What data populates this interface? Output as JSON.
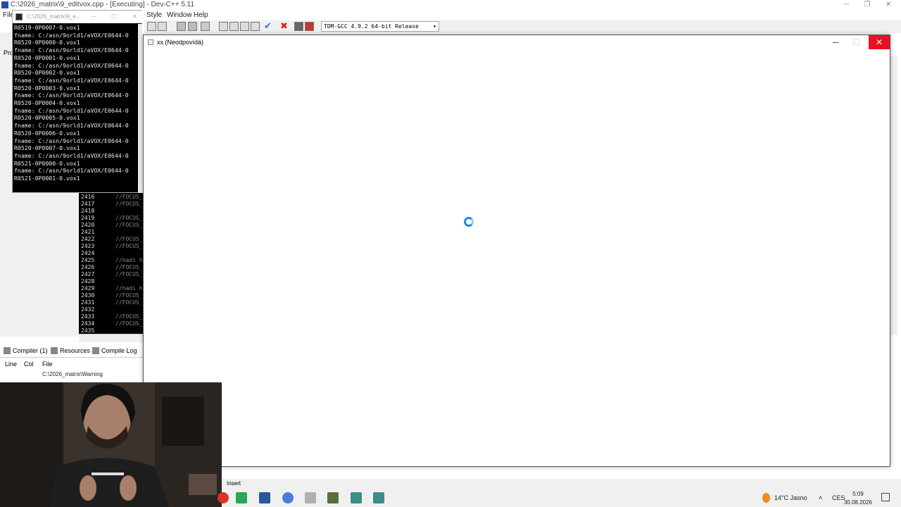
{
  "devcpp": {
    "title": "C:\\2026_matrix\\9_editvox.cpp - [Executing] - Dev-C++ 5.11",
    "menu": [
      "File",
      "Style",
      "Window",
      "Help"
    ],
    "compiler": "TDM-GCC 4.9.2 64-bit Release",
    "left_stub_1": "Pro",
    "bottom_tabs": [
      "Compiler (1)",
      "Resources",
      "Compile Log"
    ],
    "log_headers": {
      "line": "Line",
      "col": "Col",
      "file": "File"
    },
    "log_row": "C:\\2026_matrix\\Warning",
    "status": "Insert",
    "editor_lines": [
      {
        "n": "2416",
        "code": "//FOCUS_"
      },
      {
        "n": "2417",
        "code": "//FOCUS_"
      },
      {
        "n": "2418",
        "code": ""
      },
      {
        "n": "2419",
        "code": "//FOCUS_"
      },
      {
        "n": "2420",
        "code": "//FOCUS_"
      },
      {
        "n": "2421",
        "code": ""
      },
      {
        "n": "2422",
        "code": "//FOCUS_"
      },
      {
        "n": "2423",
        "code": "//FOCUS_"
      },
      {
        "n": "2424",
        "code": ""
      },
      {
        "n": "2425",
        "code": "//hadi h"
      },
      {
        "n": "2426",
        "code": "//FOCUS_"
      },
      {
        "n": "2427",
        "code": "//FOCUS_"
      },
      {
        "n": "2428",
        "code": ""
      },
      {
        "n": "2429",
        "code": "//hadi h"
      },
      {
        "n": "2430",
        "code": "//FOCUS_"
      },
      {
        "n": "2431",
        "code": "//FOCUS_"
      },
      {
        "n": "2432",
        "code": ""
      },
      {
        "n": "2433",
        "code": "//FOCUS_"
      },
      {
        "n": "2434",
        "code": "//FOCUS_"
      },
      {
        "n": "2435",
        "code": ""
      }
    ]
  },
  "console": {
    "title": "C:\\2026_matrix\\9_e...",
    "lines": [
      "R0519-0P0007-0.vox1",
      "fname: C:/asn/9orld1/aVOX/E0644-0",
      "R0520-0P0000-0.vox1",
      "fname: C:/asn/9orld1/aVOX/E0644-0",
      "R0520-0P0001-0.vox1",
      "fname: C:/asn/9orld1/aVOX/E0644-0",
      "R0520-0P0002-0.vox1",
      "fname: C:/asn/9orld1/aVOX/E0644-0",
      "R0520-0P0003-0.vox1",
      "fname: C:/asn/9orld1/aVOX/E0644-0",
      "R0520-0P0004-0.vox1",
      "fname: C:/asn/9orld1/aVOX/E0644-0",
      "R0520-0P0005-0.vox1",
      "fname: C:/asn/9orld1/aVOX/E0644-0",
      "R0520-0P0006-0.vox1",
      "fname: C:/asn/9orld1/aVOX/E0644-0",
      "R0520-0P0007-0.vox1",
      "fname: C:/asn/9orld1/aVOX/E0644-0",
      "R0521-0P0000-0.vox1",
      "fname: C:/asn/9orld1/aVOX/E0644-0",
      "R0521-0P0001-0.vox1"
    ]
  },
  "app_window": {
    "title": "xx (Neodpovídá)",
    "minimize": "─",
    "maximize": "☐",
    "close": "✕"
  },
  "taskbar": {
    "weather": "14°C  Jasno",
    "lang": "CES",
    "time": "5:09",
    "date": "30.08.2026",
    "icons": [
      "app-red-icon",
      "android-icon",
      "word-icon",
      "chrome-icon",
      "explorer-icon",
      "devcpp-icon",
      "terminal-icon",
      "app-window-icon"
    ]
  },
  "colors": {
    "accent": "#1e88e5",
    "close": "#e81123",
    "console_bg": "#000000"
  }
}
